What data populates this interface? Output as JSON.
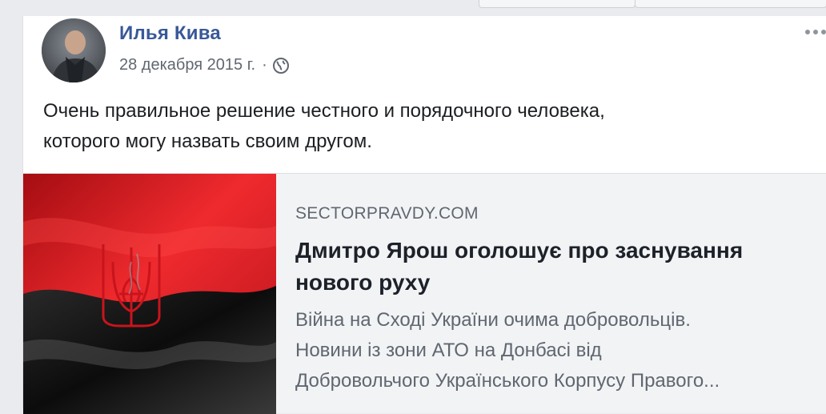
{
  "post": {
    "author_name": "Илья Кива",
    "date": "28 декабря 2015 г.",
    "separator": "·",
    "privacy_icon": "globe-icon",
    "menu_icon": "more-options-icon",
    "text_line1": "Очень правильное решение честного и порядочного человека,",
    "text_line2": "которого могу назвать своим другом."
  },
  "link_preview": {
    "domain": "SECTORPRAVDY.COM",
    "title_line1": "Дмитро Ярош оголошує про заснування",
    "title_line2": "нового руху",
    "desc_line1": "Війна на Сході України очима добровольців.",
    "desc_line2": "Новини із зони АТО на Донбасі від",
    "desc_line3": "Добровольчого Українського Корпусу Правого..."
  },
  "colors": {
    "author_link": "#385898",
    "flag_red": "#d4141c",
    "flag_black": "#111111"
  }
}
